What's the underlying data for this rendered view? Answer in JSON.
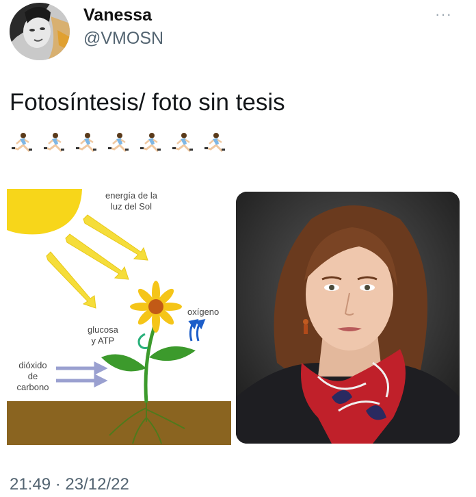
{
  "tweet": {
    "display_name": "Vanessa",
    "handle": "@VMOSN",
    "more_label": "···",
    "text": "Fotosíntesis/ foto sin tesis",
    "emoji_count": 7,
    "emoji_icon": "running-woman-icon",
    "timestamp": "21:49 · 23/12/22"
  },
  "diagram": {
    "sun_label": "energía de la luz del Sol",
    "sun_label_line1": "energía de la",
    "sun_label_line2": "luz del Sol",
    "oxygen_label": "oxígeno",
    "glucose_line1": "glucosa",
    "glucose_line2": "y ATP",
    "co2_line1": "dióxido",
    "co2_line2": "de",
    "co2_line3": "carbono"
  },
  "colors": {
    "sun": "#f7d61a",
    "soil": "#8a6420",
    "leaf": "#3c9a2c",
    "arrow_blue": "#1d5ec9",
    "arrow_gray": "#9aa0d0"
  }
}
